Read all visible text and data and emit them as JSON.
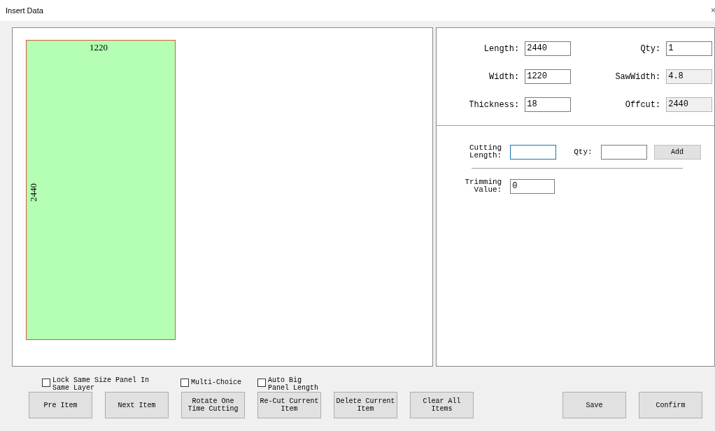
{
  "window": {
    "title": "Insert Data",
    "close": "×"
  },
  "panel_drawing": {
    "top_label": "1220",
    "side_label": "2440"
  },
  "board_fields": [
    {
      "label": "Length:",
      "value": "2440",
      "disabled": false
    },
    {
      "label": "Qty:",
      "value": "1",
      "disabled": false
    },
    {
      "label": "Width:",
      "value": "1220",
      "disabled": false
    },
    {
      "label": "SawWidth:",
      "value": "4.8",
      "disabled": true
    },
    {
      "label": "Thickness:",
      "value": "18",
      "disabled": false
    },
    {
      "label": "Offcut:",
      "value": "2440",
      "disabled": true
    }
  ],
  "cutting": {
    "length_label": "Cutting Length:",
    "length_focused": true,
    "qty_label": "Qty:",
    "add_button": "Add",
    "trim_label": "Trimming Value:",
    "trim_value": "0"
  },
  "checkboxes": [
    {
      "label": "Lock Same Size Panel In Same Layer",
      "checked": false
    },
    {
      "label": "Multi-Choice",
      "checked": false
    },
    {
      "label": "Auto Big Panel Length",
      "checked": false
    }
  ],
  "buttons": [
    "Pre Item",
    "Next Item",
    "Rotate One Time Cutting",
    "Re-Cut Current Item",
    "Delete Current Item",
    "Clear All Items"
  ],
  "right_buttons": [
    "Save",
    "Confirm"
  ]
}
